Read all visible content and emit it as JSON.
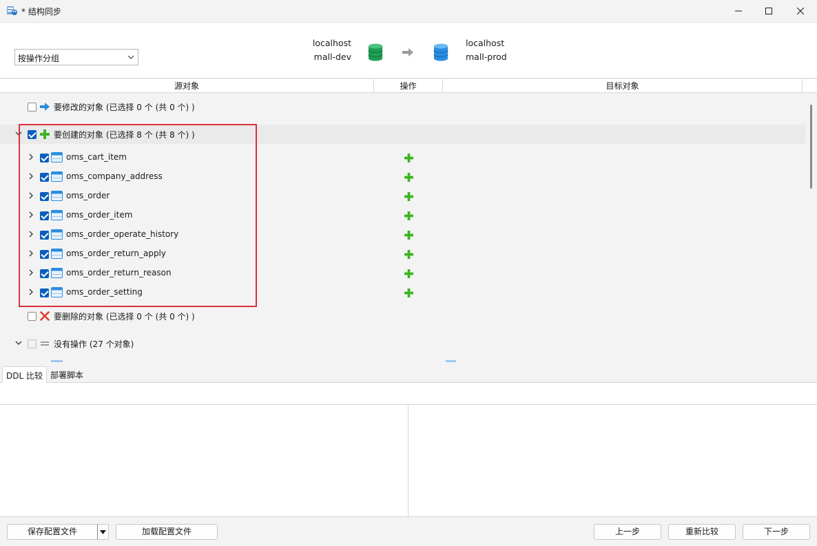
{
  "window": {
    "title": "* 结构同步",
    "controls": [
      "minimize",
      "maximize",
      "close"
    ]
  },
  "header": {
    "group_by": "按操作分组",
    "source": {
      "host": "localhost",
      "database": "mall-dev"
    },
    "target": {
      "host": "localhost",
      "database": "mall-prod"
    }
  },
  "columns": {
    "source": "源对象",
    "action": "操作",
    "target": "目标对象"
  },
  "groups": {
    "modify": "要修改的对象 (已选择 0 个 (共 0 个) )",
    "create": "要创建的对象 (已选择 8 个 (共 8 个) )",
    "delete": "要删除的对象 (已选择 0 个 (共 0 个) )",
    "none": "没有操作 (27 个对象)"
  },
  "create_items": [
    "oms_cart_item",
    "oms_company_address",
    "oms_order",
    "oms_order_item",
    "oms_order_operate_history",
    "oms_order_return_apply",
    "oms_order_return_reason",
    "oms_order_setting"
  ],
  "tabs": [
    "DDL 比较",
    "部署脚本"
  ],
  "footer": {
    "save_config": "保存配置文件",
    "load_config": "加载配置文件",
    "prev": "上一步",
    "recompare": "重新比较",
    "next": "下一步"
  },
  "colors": {
    "accent_blue": "#0a5fbd",
    "add_green": "#3cb521",
    "delete_red": "#e23b2e",
    "highlight_red": "#d9303a",
    "source_db": "#1f9d55",
    "target_db": "#2a8de0"
  }
}
